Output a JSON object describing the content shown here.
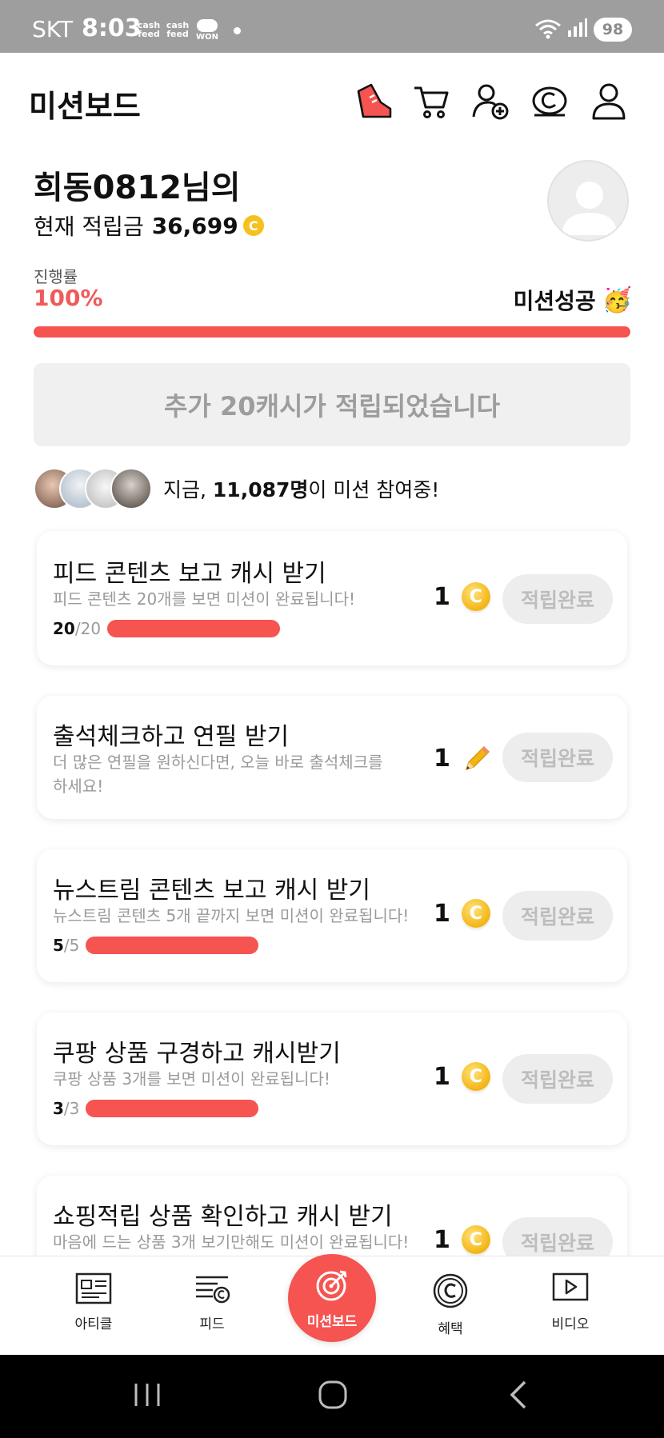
{
  "status_bar": {
    "carrier": "SKT",
    "time": "8:03",
    "cf1": "cash feed",
    "cf2": "cash feed",
    "won": "WON",
    "battery": "98"
  },
  "header": {
    "title": "미션보드",
    "icons": [
      "shoe-icon",
      "cart-icon",
      "add-friend-icon",
      "coin-icon",
      "profile-icon"
    ]
  },
  "profile": {
    "greeting": "희동0812님의",
    "balance_label": "현재 적립금",
    "balance": "36,699",
    "coin_symbol": "C"
  },
  "progress": {
    "label": "진행률",
    "percent_text": "100%",
    "value": 1.0,
    "status": "미션성공",
    "emoji": "🥳"
  },
  "notice": "추가 20캐시가 적립되었습니다",
  "participants": {
    "prefix": "지금, ",
    "count": "11,087명",
    "suffix": "이 미션 참여중!"
  },
  "missions": [
    {
      "title": "피드 콘텐츠 보고 캐시 받기",
      "desc": "피드 콘텐츠 20개를 보면 미션이 완료됩니다!",
      "progress_current": "20",
      "progress_sep": "/",
      "progress_total": "20",
      "progress_ratio": 1.0,
      "reward": "1",
      "reward_icon": "coin-icon",
      "button": "적립완료"
    },
    {
      "title": "출석체크하고 연필 받기",
      "desc": "더 많은 연필을 원하신다면, 오늘 바로 출석체크를 하세요!",
      "reward": "1",
      "reward_icon": "pencil-icon",
      "button": "적립완료"
    },
    {
      "title": "뉴스트림 콘텐츠 보고 캐시 받기",
      "desc": "뉴스트림 콘텐츠 5개 끝까지 보면 미션이 완료됩니다!",
      "progress_current": "5",
      "progress_sep": "/",
      "progress_total": "5",
      "progress_ratio": 1.0,
      "reward": "1",
      "reward_icon": "coin-icon",
      "button": "적립완료"
    },
    {
      "title": "쿠팡 상품 구경하고 캐시받기",
      "desc": "쿠팡 상품 3개를 보면 미션이 완료됩니다!",
      "progress_current": "3",
      "progress_sep": "/",
      "progress_total": "3",
      "progress_ratio": 1.0,
      "reward": "1",
      "reward_icon": "coin-icon",
      "button": "적립완료"
    },
    {
      "title": "쇼핑적립 상품 확인하고 캐시 받기",
      "desc": "마음에 드는 상품 3개 보기만해도 미션이 완료됩니다!",
      "reward": "1",
      "reward_icon": "coin-icon",
      "button": "적립완료"
    }
  ],
  "coin_symbol": "C",
  "bottom_nav": [
    {
      "label": "아티클",
      "icon": "article-icon"
    },
    {
      "label": "피드",
      "icon": "feed-icon"
    },
    {
      "label": "미션보드",
      "icon": "target-icon",
      "active": true
    },
    {
      "label": "혜택",
      "icon": "benefit-icon"
    },
    {
      "label": "비디오",
      "icon": "video-icon"
    }
  ],
  "colors": {
    "accent": "#f55451",
    "coin": "#f3b514",
    "status_bar": "#9e9e9e"
  }
}
